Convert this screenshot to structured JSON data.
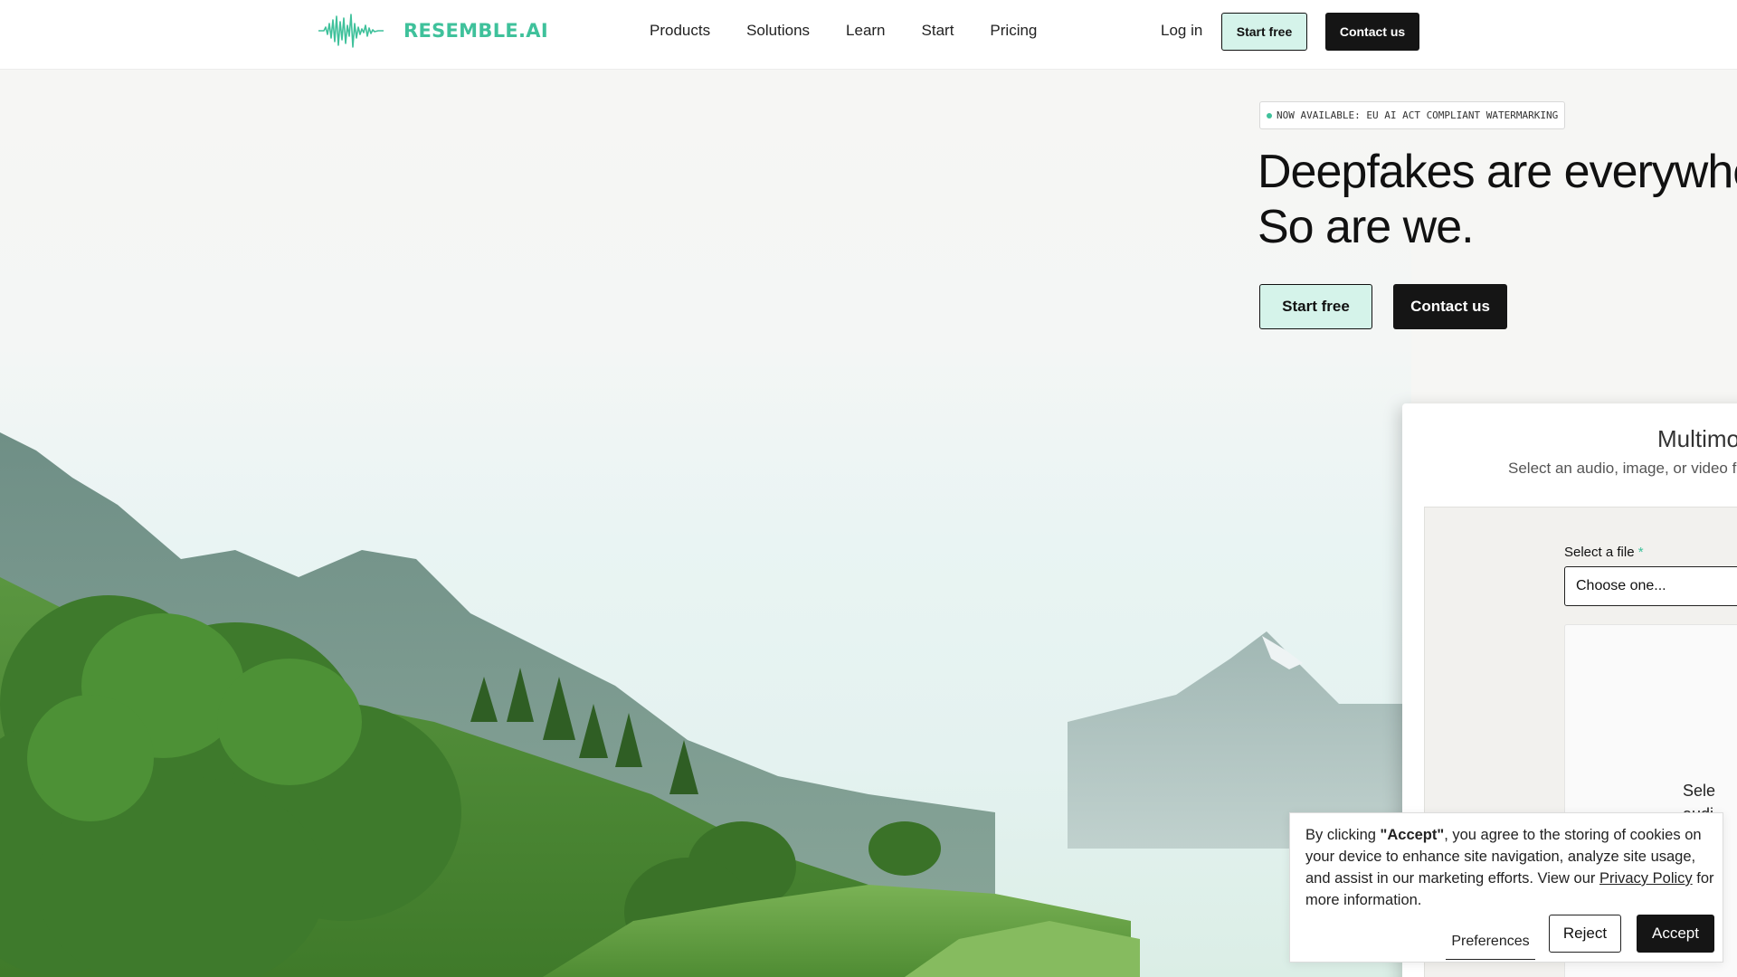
{
  "brand": {
    "name": "RESEMBLE.AI",
    "accent": "#3fc19b",
    "dark": "#151515",
    "mint": "#d5f3ea",
    "logo_icon": "waveform-icon"
  },
  "nav": {
    "links": [
      "Products",
      "Solutions",
      "Learn",
      "Start",
      "Pricing"
    ],
    "login": "Log in",
    "start_free": "Start free",
    "contact": "Contact us"
  },
  "hero": {
    "badge": "NOW AVAILABLE: EU AI ACT COMPLIANT WATERMARKING",
    "headline_line1": "Deepfakes are everywhere",
    "headline_line2": "So are we.",
    "start_free": "Start free",
    "contact": "Contact us",
    "background": "mountain-landscape-image"
  },
  "detect_card": {
    "title": "Multimo",
    "subtitle": "Select an audio, image, or video f",
    "file_label": "Select a file",
    "required_mark": "*",
    "file_value": "Choose one...",
    "drop_line1": "Sele",
    "drop_line2": "audi"
  },
  "cookie": {
    "text_before": "By clicking ",
    "text_bold": "\"Accept\"",
    "text_after": ", you agree to the storing of cookies on your device to enhance site navigation, analyze site usage, and assist in our marketing efforts. View our ",
    "link": "Privacy Policy",
    "text_end": " for more information.",
    "preferences": "Preferences",
    "reject": "Reject",
    "accept": "Accept"
  }
}
